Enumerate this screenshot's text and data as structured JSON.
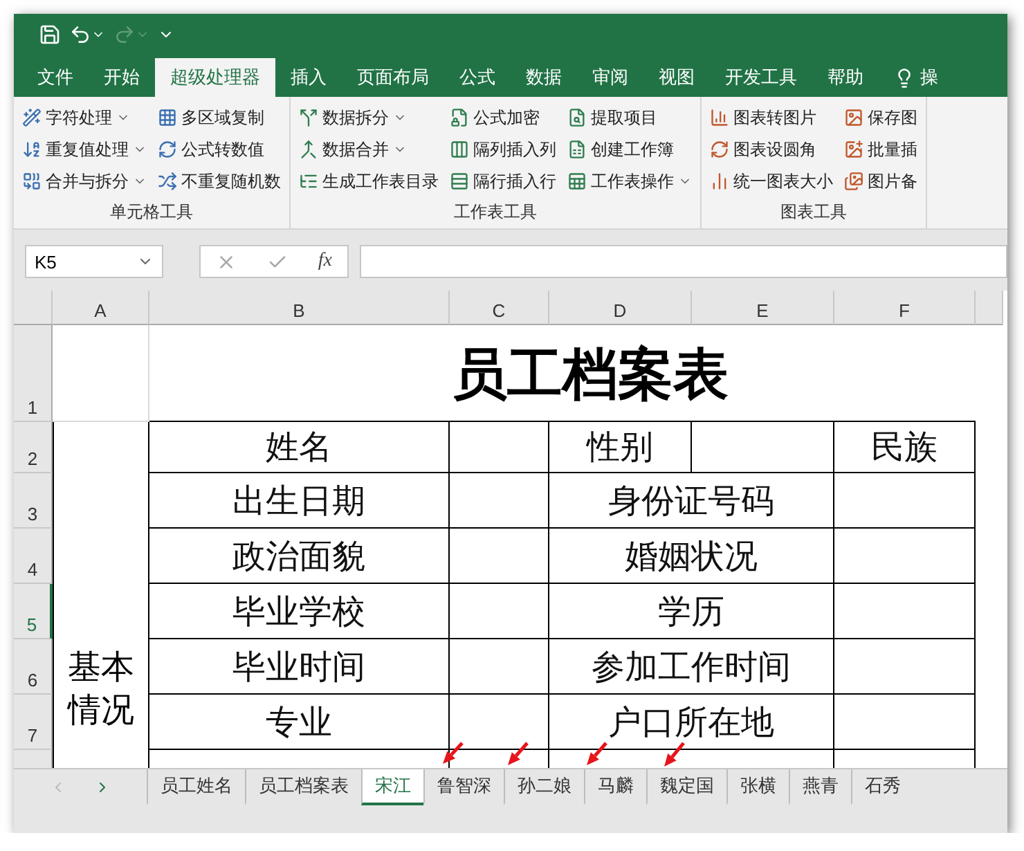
{
  "ribbon_tabs": [
    {
      "label": "文件",
      "selected": false
    },
    {
      "label": "开始",
      "selected": false
    },
    {
      "label": "超级处理器",
      "selected": true
    },
    {
      "label": "插入",
      "selected": false
    },
    {
      "label": "页面布局",
      "selected": false
    },
    {
      "label": "公式",
      "selected": false
    },
    {
      "label": "数据",
      "selected": false
    },
    {
      "label": "审阅",
      "selected": false
    },
    {
      "label": "视图",
      "selected": false
    },
    {
      "label": "开发工具",
      "selected": false
    },
    {
      "label": "帮助",
      "selected": false
    },
    {
      "label": "操",
      "selected": false
    }
  ],
  "ribbon_groups": [
    {
      "title": "单元格工具",
      "columns": [
        [
          {
            "label": "字符处理",
            "dropdown": true
          },
          {
            "label": "重复值处理",
            "dropdown": true
          },
          {
            "label": "合并与拆分",
            "dropdown": true
          }
        ],
        [
          {
            "label": "多区域复制",
            "dropdown": false
          },
          {
            "label": "公式转数值",
            "dropdown": false
          },
          {
            "label": "不重复随机数",
            "dropdown": false
          }
        ]
      ]
    },
    {
      "title": "工作表工具",
      "columns": [
        [
          {
            "label": "数据拆分",
            "dropdown": true
          },
          {
            "label": "数据合并",
            "dropdown": true
          },
          {
            "label": "生成工作表目录",
            "dropdown": false
          }
        ],
        [
          {
            "label": "公式加密",
            "dropdown": false
          },
          {
            "label": "隔列插入列",
            "dropdown": false
          },
          {
            "label": "隔行插入行",
            "dropdown": false
          }
        ],
        [
          {
            "label": "提取项目",
            "dropdown": false
          },
          {
            "label": "创建工作簿",
            "dropdown": false
          },
          {
            "label": "工作表操作",
            "dropdown": true
          }
        ]
      ]
    },
    {
      "title": "图表工具",
      "columns": [
        [
          {
            "label": "图表转图片",
            "dropdown": false
          },
          {
            "label": "图表设圆角",
            "dropdown": false
          },
          {
            "label": "统一图表大小",
            "dropdown": false
          }
        ],
        [
          {
            "label": "保存图",
            "dropdown": false
          },
          {
            "label": "批量插",
            "dropdown": false
          },
          {
            "label": "图片备",
            "dropdown": false
          }
        ]
      ]
    }
  ],
  "formula_bar": {
    "name_box": "K5",
    "function_label": "fx"
  },
  "columns": [
    "A",
    "B",
    "C",
    "D",
    "E",
    "F"
  ],
  "rows": [
    {
      "number": "1",
      "selected": false
    },
    {
      "number": "2",
      "selected": false
    },
    {
      "number": "3",
      "selected": false
    },
    {
      "number": "4",
      "selected": false
    },
    {
      "number": "5",
      "selected": true
    },
    {
      "number": "6",
      "selected": false
    },
    {
      "number": "7",
      "selected": false
    }
  ],
  "sheet": {
    "title": "员工档案表",
    "section_label": "基本情况",
    "header_row": [
      "姓名",
      "性别",
      "民族"
    ],
    "form_rows": [
      [
        "出生日期",
        "身份证号码"
      ],
      [
        "政治面貌",
        "婚姻状况"
      ],
      [
        "毕业学校",
        "学历"
      ],
      [
        "毕业时间",
        "参加工作时间"
      ],
      [
        "专业",
        "户口所在地"
      ]
    ]
  },
  "sheet_tabs": [
    {
      "label": "员工姓名",
      "selected": false
    },
    {
      "label": "员工档案表",
      "selected": false
    },
    {
      "label": "宋江",
      "selected": true
    },
    {
      "label": "鲁智深",
      "selected": false
    },
    {
      "label": "孙二娘",
      "selected": false
    },
    {
      "label": "马麟",
      "selected": false
    },
    {
      "label": "魏定国",
      "selected": false
    },
    {
      "label": "张横",
      "selected": false
    },
    {
      "label": "燕青",
      "selected": false
    },
    {
      "label": "石秀",
      "selected": false
    }
  ]
}
